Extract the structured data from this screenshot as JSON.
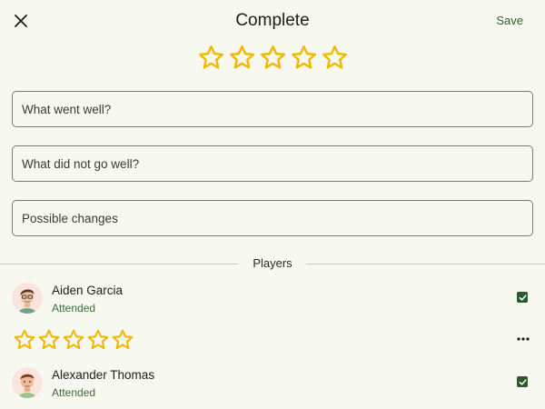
{
  "header": {
    "title": "Complete",
    "save_label": "Save",
    "close_icon": "close-icon"
  },
  "rating": {
    "value": 0,
    "max": 5,
    "star_color": "#f2b800"
  },
  "fields": [
    {
      "placeholder": "What went well?",
      "value": ""
    },
    {
      "placeholder": "What did not go well?",
      "value": ""
    },
    {
      "placeholder": "Possible changes",
      "value": ""
    }
  ],
  "players_section": {
    "label": "Players"
  },
  "players": [
    {
      "name": "Aiden Garcia",
      "status": "Attended",
      "checked": true,
      "rating": 0
    },
    {
      "name": "Alexander Thomas",
      "status": "Attended",
      "checked": true
    }
  ],
  "colors": {
    "background": "#f7f8ef",
    "accent_green": "#2d5a2d",
    "status_green": "#3d6b36"
  }
}
